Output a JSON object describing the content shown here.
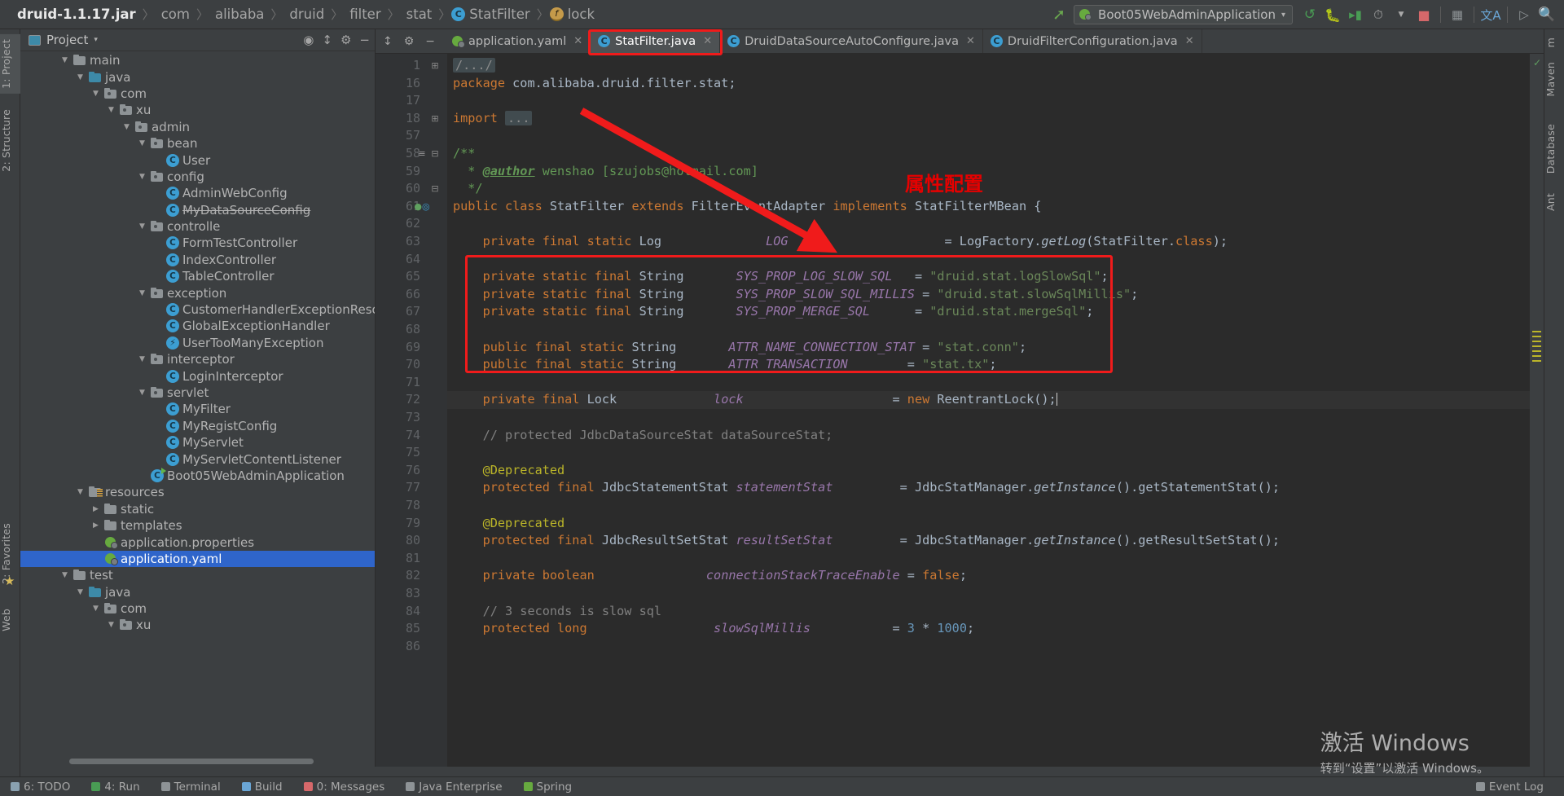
{
  "breadcrumb": {
    "items": [
      {
        "label": "druid-1.1.17.jar",
        "icon": "none",
        "bold": true
      },
      {
        "label": "com",
        "icon": "none",
        "bold": false
      },
      {
        "label": "alibaba",
        "icon": "none",
        "bold": false
      },
      {
        "label": "druid",
        "icon": "none",
        "bold": false
      },
      {
        "label": "filter",
        "icon": "none",
        "bold": false
      },
      {
        "label": "stat",
        "icon": "none",
        "bold": false
      },
      {
        "label": "StatFilter",
        "icon": "class-icon",
        "bold": false
      },
      {
        "label": "lock",
        "icon": "field-icon",
        "bold": false
      }
    ],
    "separator": "〉"
  },
  "toolbar": {
    "run_config_label": "Boot05WebAdminApplication",
    "run_config_caret": "▾",
    "buttons": [
      {
        "name": "build-icon",
        "glyph": "↻",
        "color": "#499c54"
      },
      {
        "name": "run-icon",
        "glyph": "▶",
        "color": "#499c54"
      },
      {
        "name": "debug-icon",
        "glyph": "◉",
        "color": "#499c54"
      },
      {
        "name": "run-with-coverage-icon",
        "glyph": "▷",
        "color": "#499c54"
      },
      {
        "name": "profiler-dropdown-icon",
        "glyph": "▾",
        "color": "#a9a9a9"
      },
      {
        "name": "stop-icon",
        "glyph": "■",
        "color": "#d6686a"
      },
      {
        "name": "project-structure-icon",
        "glyph": "▤",
        "color": "#8e9396"
      },
      {
        "name": "translate-icon",
        "glyph": "文A",
        "color": "#6aa6d6"
      },
      {
        "name": "terminal-icon",
        "glyph": "▷",
        "color": "#8e9396"
      },
      {
        "name": "search-everywhere-icon",
        "glyph": "⚲",
        "color": "#b0b0b0"
      }
    ],
    "updates_icon": "↖"
  },
  "left_tool_window_tabs": [
    {
      "label": "1: Project",
      "active": true
    },
    {
      "label": "2: Structure",
      "active": false
    },
    {
      "label": "2: Favorites",
      "active": false
    },
    {
      "label": "Web",
      "active": false
    }
  ],
  "right_tool_window_tabs": [
    {
      "label": "m",
      "active": false
    },
    {
      "label": "Maven",
      "active": false
    },
    {
      "label": "Database",
      "active": false
    },
    {
      "label": "Ant",
      "active": false
    },
    {
      "label": "Event Log",
      "active": false
    }
  ],
  "project_panel": {
    "title": "Project",
    "caret": "▾",
    "header_icons": [
      "locate-icon",
      "collapse-all-icon",
      "settings-icon",
      "hide-icon"
    ],
    "tree": [
      {
        "depth": 2,
        "arrow": "▼",
        "icon": "folder",
        "label": "main",
        "selected": false
      },
      {
        "depth": 3,
        "arrow": "▼",
        "icon": "folder-source",
        "label": "java",
        "selected": false
      },
      {
        "depth": 4,
        "arrow": "▼",
        "icon": "package",
        "label": "com",
        "selected": false
      },
      {
        "depth": 5,
        "arrow": "▼",
        "icon": "package",
        "label": "xu",
        "selected": false
      },
      {
        "depth": 6,
        "arrow": "▼",
        "icon": "package",
        "label": "admin",
        "selected": false
      },
      {
        "depth": 7,
        "arrow": "▼",
        "icon": "package",
        "label": "bean",
        "selected": false
      },
      {
        "depth": 8,
        "arrow": "",
        "icon": "class",
        "label": "User",
        "selected": false
      },
      {
        "depth": 7,
        "arrow": "▼",
        "icon": "package",
        "label": "config",
        "selected": false
      },
      {
        "depth": 8,
        "arrow": "",
        "icon": "class",
        "label": "AdminWebConfig",
        "selected": false
      },
      {
        "depth": 8,
        "arrow": "",
        "icon": "class",
        "label": "MyDataSourceConfig",
        "selected": false,
        "strike": true
      },
      {
        "depth": 7,
        "arrow": "▼",
        "icon": "package",
        "label": "controlle",
        "selected": false
      },
      {
        "depth": 8,
        "arrow": "",
        "icon": "class",
        "label": "FormTestController",
        "selected": false
      },
      {
        "depth": 8,
        "arrow": "",
        "icon": "class",
        "label": "IndexController",
        "selected": false
      },
      {
        "depth": 8,
        "arrow": "",
        "icon": "class",
        "label": "TableController",
        "selected": false
      },
      {
        "depth": 7,
        "arrow": "▼",
        "icon": "package",
        "label": "exception",
        "selected": false
      },
      {
        "depth": 8,
        "arrow": "",
        "icon": "class",
        "label": "CustomerHandlerExceptionResolver",
        "selected": false
      },
      {
        "depth": 8,
        "arrow": "",
        "icon": "class",
        "label": "GlobalExceptionHandler",
        "selected": false
      },
      {
        "depth": 8,
        "arrow": "",
        "icon": "exception-class",
        "label": "UserTooManyException",
        "selected": false
      },
      {
        "depth": 7,
        "arrow": "▼",
        "icon": "package",
        "label": "interceptor",
        "selected": false
      },
      {
        "depth": 8,
        "arrow": "",
        "icon": "class",
        "label": "LoginInterceptor",
        "selected": false
      },
      {
        "depth": 7,
        "arrow": "▼",
        "icon": "package",
        "label": "servlet",
        "selected": false
      },
      {
        "depth": 8,
        "arrow": "",
        "icon": "class",
        "label": "MyFilter",
        "selected": false
      },
      {
        "depth": 8,
        "arrow": "",
        "icon": "class",
        "label": "MyRegistConfig",
        "selected": false
      },
      {
        "depth": 8,
        "arrow": "",
        "icon": "class",
        "label": "MyServlet",
        "selected": false
      },
      {
        "depth": 8,
        "arrow": "",
        "icon": "class",
        "label": "MyServletContentListener",
        "selected": false
      },
      {
        "depth": 7,
        "arrow": "",
        "icon": "spring-class",
        "label": "Boot05WebAdminApplication",
        "selected": false
      },
      {
        "depth": 3,
        "arrow": "▼",
        "icon": "folder-resources",
        "label": "resources",
        "selected": false
      },
      {
        "depth": 4,
        "arrow": "▶",
        "icon": "folder",
        "label": "static",
        "selected": false
      },
      {
        "depth": 4,
        "arrow": "▶",
        "icon": "folder",
        "label": "templates",
        "selected": false
      },
      {
        "depth": 4,
        "arrow": "",
        "icon": "yaml",
        "label": "application.properties",
        "selected": false
      },
      {
        "depth": 4,
        "arrow": "",
        "icon": "yaml",
        "label": "application.yaml",
        "selected": true
      },
      {
        "depth": 2,
        "arrow": "▼",
        "icon": "folder",
        "label": "test",
        "selected": false
      },
      {
        "depth": 3,
        "arrow": "▼",
        "icon": "folder-source",
        "label": "java",
        "selected": false
      },
      {
        "depth": 4,
        "arrow": "▼",
        "icon": "package",
        "label": "com",
        "selected": false
      },
      {
        "depth": 5,
        "arrow": "▼",
        "icon": "package",
        "label": "xu",
        "selected": false
      }
    ]
  },
  "editor": {
    "tabs": [
      {
        "label": "application.yaml",
        "icon": "yaml-icon",
        "active": false
      },
      {
        "label": "StatFilter.java",
        "icon": "class-icon",
        "active": true
      },
      {
        "label": "DruidDataSourceAutoConfigure.java",
        "icon": "class-icon",
        "active": false
      },
      {
        "label": "DruidFilterConfiguration.java",
        "icon": "class-icon",
        "active": false
      }
    ],
    "tab_close_glyph": "✕",
    "lines": [
      {
        "num": "1",
        "marks": "",
        "fold": "+",
        "html": "<span class=\"fold\">/.../</span>"
      },
      {
        "num": "16",
        "marks": "",
        "fold": "",
        "html": "<span class=\"kw\">package</span> com.alibaba.druid.filter.stat;"
      },
      {
        "num": "17",
        "marks": "",
        "fold": "",
        "html": ""
      },
      {
        "num": "18",
        "marks": "",
        "fold": "+",
        "html": "<span class=\"kw\">import</span> <span class=\"fold\">...</span>"
      },
      {
        "num": "57",
        "marks": "",
        "fold": "",
        "html": ""
      },
      {
        "num": "58",
        "marks": "≡",
        "fold": "-",
        "html": "<span class=\"doc\">/**</span>"
      },
      {
        "num": "59",
        "marks": "",
        "fold": "",
        "html": "<span class=\"doc\">  * </span><span class=\"doctag\">@author</span><span class=\"doc\"> wenshao [szujobs@hotmail.com]</span>"
      },
      {
        "num": "60",
        "marks": "",
        "fold": "-",
        "html": "<span class=\"doc\">  */</span>"
      },
      {
        "num": "61",
        "marks": "icons",
        "fold": "",
        "html": "<span class=\"kw\">public class </span>StatFilter <span class=\"kw\">extends </span>FilterEventAdapter <span class=\"kw\">implements </span>StatFilterMBean {"
      },
      {
        "num": "62",
        "marks": "",
        "fold": "",
        "html": ""
      },
      {
        "num": "63",
        "marks": "",
        "fold": "",
        "html": "    <span class=\"kw\">private final static </span>Log              <span class=\"field\">LOG</span>                     = LogFactory.<span class=\"meth\">getLog</span>(StatFilter.<span class=\"kw\">class</span>);"
      },
      {
        "num": "64",
        "marks": "",
        "fold": "",
        "html": ""
      },
      {
        "num": "65",
        "marks": "",
        "fold": "",
        "html": "    <span class=\"kw\">private static final </span>String       <span class=\"field\">SYS_PROP_LOG_SLOW_SQL</span>   = <span class=\"str\">\"druid.stat.logSlowSql\"</span>;"
      },
      {
        "num": "66",
        "marks": "",
        "fold": "",
        "html": "    <span class=\"kw\">private static final </span>String       <span class=\"field\">SYS_PROP_SLOW_SQL_MILLIS</span> = <span class=\"str\">\"druid.stat.slowSqlMillis\"</span>;"
      },
      {
        "num": "67",
        "marks": "",
        "fold": "",
        "html": "    <span class=\"kw\">private static final </span>String       <span class=\"field\">SYS_PROP_MERGE_SQL</span>      = <span class=\"str\">\"druid.stat.mergeSql\"</span>;"
      },
      {
        "num": "68",
        "marks": "",
        "fold": "",
        "html": ""
      },
      {
        "num": "69",
        "marks": "",
        "fold": "",
        "html": "    <span class=\"kw\">public final static </span>String       <span class=\"field\">ATTR_NAME_CONNECTION_STAT</span> = <span class=\"str\">\"stat.conn\"</span>;"
      },
      {
        "num": "70",
        "marks": "",
        "fold": "",
        "html": "    <span class=\"kw\">public final static </span>String       <span class=\"field\">ATTR_TRANSACTION</span>        = <span class=\"str\">\"stat.tx\"</span>;"
      },
      {
        "num": "71",
        "marks": "",
        "fold": "",
        "html": ""
      },
      {
        "num": "72",
        "marks": "",
        "fold": "",
        "hl": true,
        "html": "    <span class=\"kw\">private final </span>Lock             <span class=\"field\">lock</span>                    = <span class=\"kw\">new </span>ReentrantLock();<span class=\"caret-bar\"></span>"
      },
      {
        "num": "73",
        "marks": "",
        "fold": "",
        "html": ""
      },
      {
        "num": "74",
        "marks": "",
        "fold": "",
        "html": "    <span class=\"cmt\">// protected JdbcDataSourceStat dataSourceStat;</span>"
      },
      {
        "num": "75",
        "marks": "",
        "fold": "",
        "html": ""
      },
      {
        "num": "76",
        "marks": "",
        "fold": "",
        "html": "    <span class=\"ann\">@Deprecated</span>"
      },
      {
        "num": "77",
        "marks": "",
        "fold": "",
        "html": "    <span class=\"kw\">protected final </span>JdbcStatementStat <span class=\"field\">statementStat</span>         = JdbcStatManager.<span class=\"meth\">getInstance</span>().getStatementStat();"
      },
      {
        "num": "78",
        "marks": "",
        "fold": "",
        "html": ""
      },
      {
        "num": "79",
        "marks": "",
        "fold": "",
        "html": "    <span class=\"ann\">@Deprecated</span>"
      },
      {
        "num": "80",
        "marks": "",
        "fold": "",
        "html": "    <span class=\"kw\">protected final </span>JdbcResultSetStat <span class=\"field\">resultSetStat</span>         = JdbcStatManager.<span class=\"meth\">getInstance</span>().getResultSetStat();"
      },
      {
        "num": "81",
        "marks": "",
        "fold": "",
        "html": ""
      },
      {
        "num": "82",
        "marks": "",
        "fold": "",
        "html": "    <span class=\"kw\">private boolean </span>              <span class=\"field\">connectionStackTraceEnable</span> = <span class=\"kw\">false</span>;"
      },
      {
        "num": "83",
        "marks": "",
        "fold": "",
        "html": ""
      },
      {
        "num": "84",
        "marks": "",
        "fold": "",
        "html": "    <span class=\"cmt\">// 3 seconds is slow sql</span>"
      },
      {
        "num": "85",
        "marks": "",
        "fold": "",
        "html": "    <span class=\"kw\">protected long </span>                <span class=\"field\">slowSqlMillis</span>           = <span class=\"num\">3</span> * <span class=\"num\">1000</span>;"
      },
      {
        "num": "86",
        "marks": "",
        "fold": "",
        "html": ""
      }
    ]
  },
  "annotations": {
    "label_text": "属性配置",
    "label_color": "#e60000",
    "rect_color": "#f01b1b"
  },
  "watermark": {
    "line1": "激活 Windows",
    "line2": "转到“设置”以激活 Windows。"
  },
  "statusbar": {
    "left_items": [
      {
        "label": "6: TODO",
        "icon": "todo-icon"
      },
      {
        "label": "4: Run",
        "icon": "run-icon"
      },
      {
        "label": "Terminal",
        "icon": "terminal-icon"
      },
      {
        "label": "Build",
        "icon": "build-icon"
      },
      {
        "label": "0: Messages",
        "icon": "messages-icon"
      },
      {
        "label": "Java Enterprise",
        "icon": "java-ee-icon"
      },
      {
        "label": "Spring",
        "icon": "spring-icon"
      }
    ],
    "right_items": [
      {
        "label": "Event Log",
        "icon": "event-log-icon"
      }
    ]
  }
}
